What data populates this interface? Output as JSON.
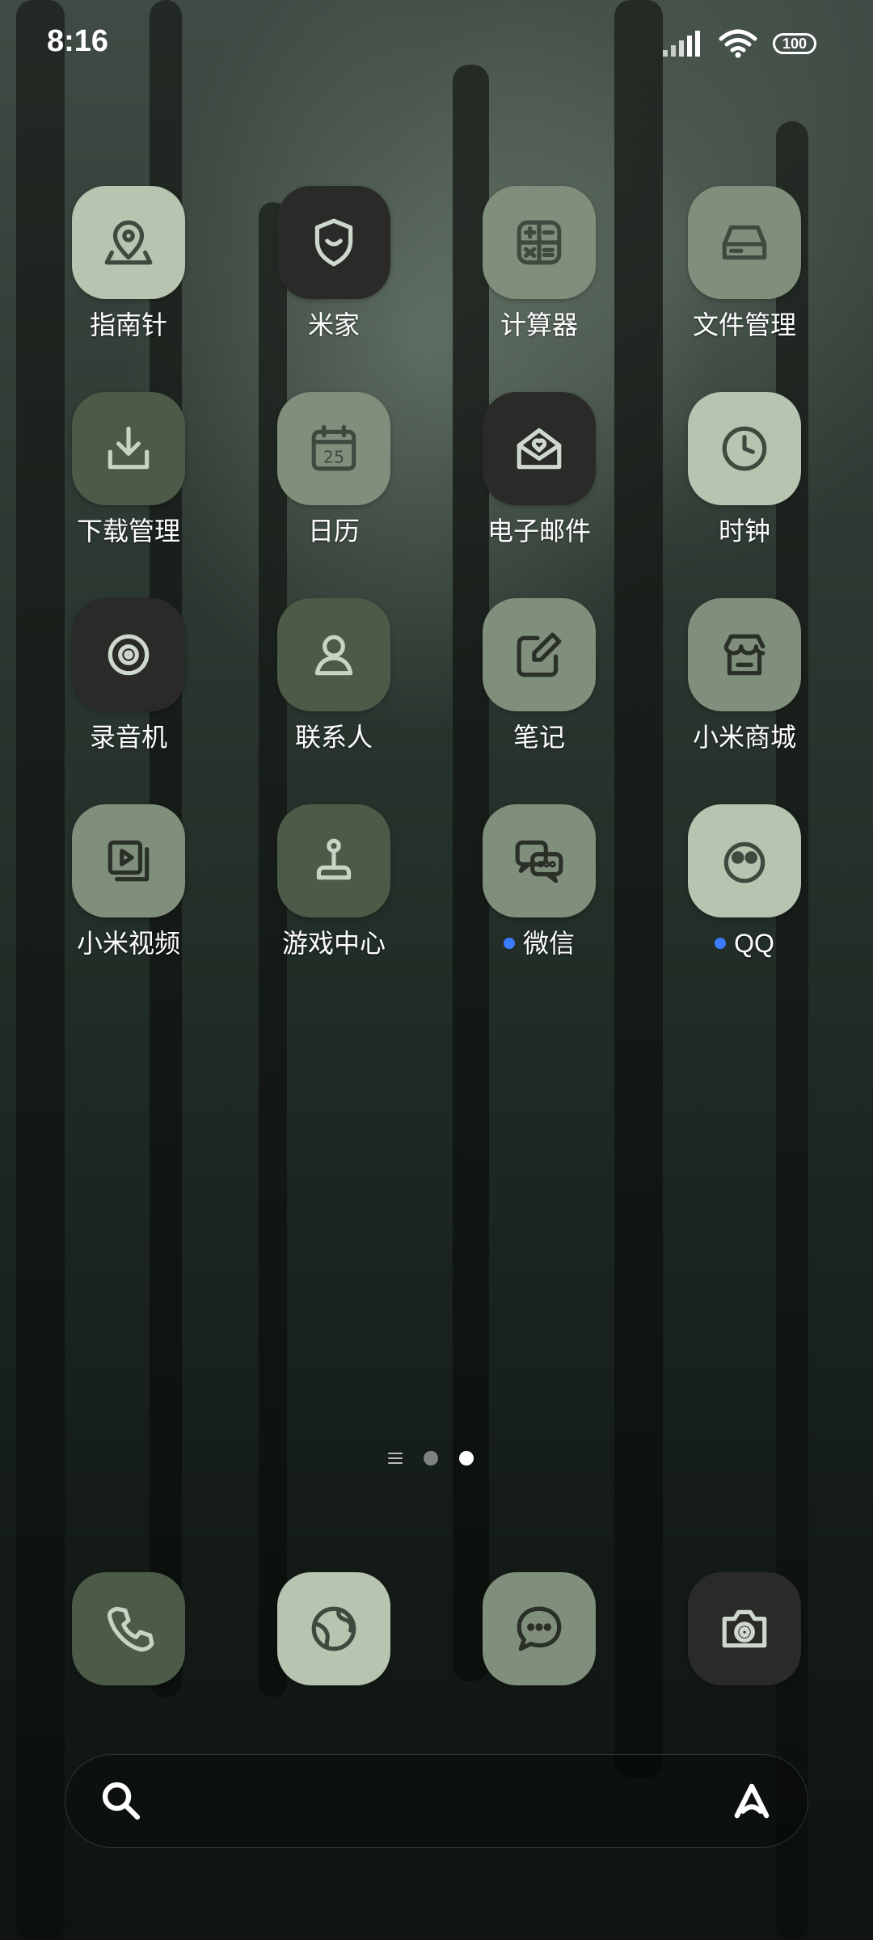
{
  "status": {
    "time": "8:16",
    "battery": "100"
  },
  "apps": [
    {
      "label": "指南针",
      "icon": "compass-map-icon"
    },
    {
      "label": "米家",
      "icon": "shield-smile-icon"
    },
    {
      "label": "计算器",
      "icon": "calculator-icon"
    },
    {
      "label": "文件管理",
      "icon": "drive-icon"
    },
    {
      "label": "下载管理",
      "icon": "download-icon"
    },
    {
      "label": "日历",
      "icon": "calendar-icon",
      "day": "25"
    },
    {
      "label": "电子邮件",
      "icon": "mail-heart-icon"
    },
    {
      "label": "时钟",
      "icon": "clock-icon"
    },
    {
      "label": "录音机",
      "icon": "recorder-icon"
    },
    {
      "label": "联系人",
      "icon": "person-icon"
    },
    {
      "label": "笔记",
      "icon": "notes-edit-icon"
    },
    {
      "label": "小米商城",
      "icon": "store-icon"
    },
    {
      "label": "小米视频",
      "icon": "video-icon"
    },
    {
      "label": "游戏中心",
      "icon": "joystick-icon"
    },
    {
      "label": "微信",
      "icon": "wechat-icon"
    },
    {
      "label": "QQ",
      "icon": "qq-icon"
    }
  ],
  "dock": [
    {
      "name": "phone",
      "icon": "phone-icon"
    },
    {
      "name": "browser",
      "icon": "globe-icon"
    },
    {
      "name": "messages",
      "icon": "message-bubble-icon"
    },
    {
      "name": "camera",
      "icon": "camera-icon"
    }
  ],
  "search": {
    "icon": "search-icon",
    "assistant_icon": "assistant-a-icon"
  }
}
